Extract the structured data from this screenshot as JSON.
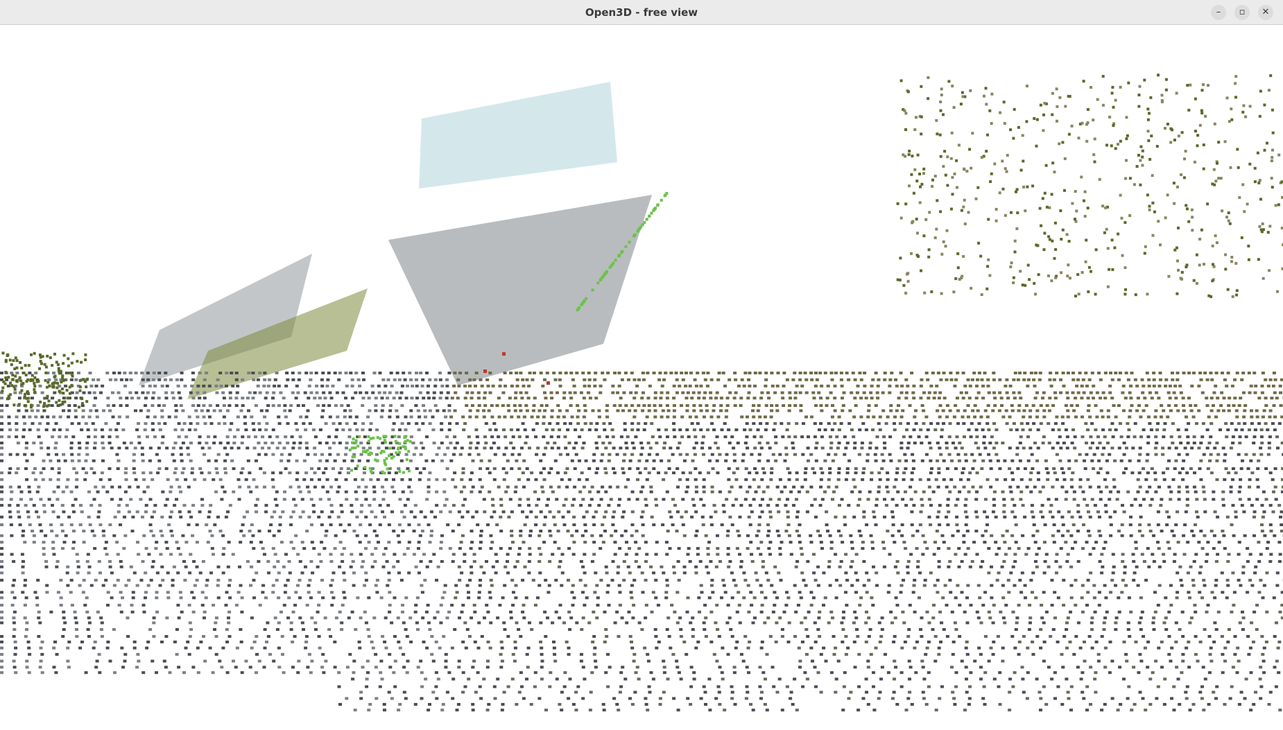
{
  "window": {
    "title": "Open3D - free view"
  },
  "controls": {
    "minimize_icon": "minimize-icon",
    "maximize_icon": "maximize-icon",
    "close_icon": "close-icon",
    "minimize_glyph": "–",
    "maximize_glyph": "▫",
    "close_glyph": "✕"
  },
  "viewport": {
    "background": "#ffffff",
    "content": "point-cloud"
  },
  "colors": {
    "titlebar_bg": "#ebebeb",
    "title_text": "#3a3a3a",
    "ground_dark": "#4a4d52",
    "ground_olive": "#6f6a48",
    "road_gray": "#9aa0a3",
    "grass": "#7d8a3c",
    "tree": "#5a6a2a",
    "sky_blue": "#cfe6ea",
    "bright_green": "#6cc24a",
    "red": "#c0392b"
  }
}
